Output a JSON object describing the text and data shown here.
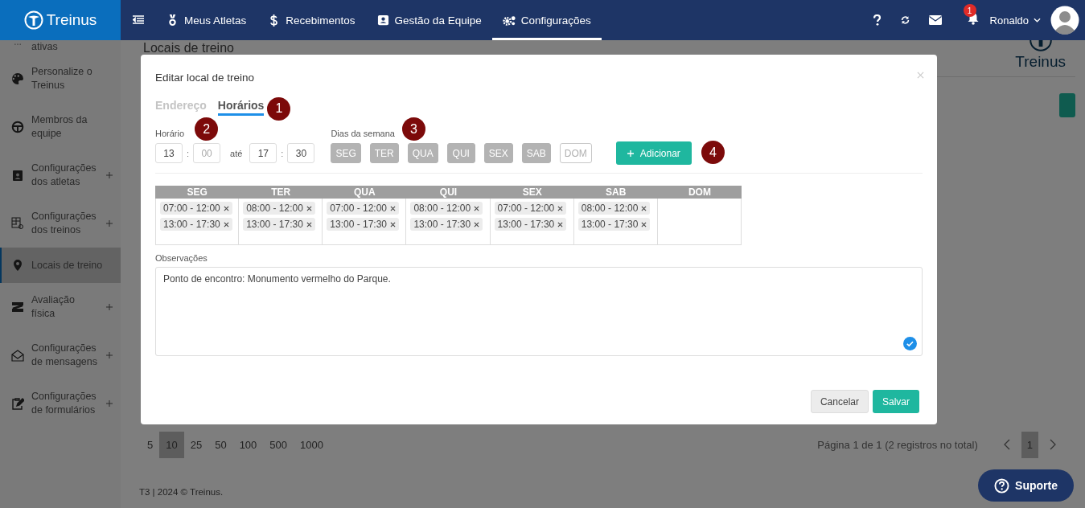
{
  "navbar": {
    "logo": "Treinus",
    "items": [
      {
        "label": "Meus Atletas",
        "selected": false
      },
      {
        "label": "Recebimentos",
        "selected": false
      },
      {
        "label": "Gestão da Equipe",
        "selected": false
      },
      {
        "label": "Configurações",
        "selected": true
      }
    ],
    "notification_count": "1",
    "user": "Ronaldo"
  },
  "sidebar": {
    "items": [
      {
        "label": "ativas",
        "expandable": false,
        "selected": false
      },
      {
        "label": "Personalize o Treinus",
        "expandable": false,
        "selected": false
      },
      {
        "label": "Membros da equipe",
        "expandable": false,
        "selected": false
      },
      {
        "label": "Configurações dos atletas",
        "expandable": true,
        "selected": false
      },
      {
        "label": "Configurações dos treinos",
        "expandable": true,
        "selected": false
      },
      {
        "label": "Locais de treino",
        "expandable": false,
        "selected": true
      },
      {
        "label": "Avaliação física",
        "expandable": true,
        "selected": false
      },
      {
        "label": "Configurações de mensagens",
        "expandable": true,
        "selected": false
      },
      {
        "label": "Configurações de formulários",
        "expandable": true,
        "selected": false
      }
    ]
  },
  "page": {
    "title": "Locais de treino",
    "background_logo": "Treinus",
    "page_sizes": [
      {
        "label": "5",
        "selected": false
      },
      {
        "label": "10",
        "selected": true
      },
      {
        "label": "25",
        "selected": false
      },
      {
        "label": "50",
        "selected": false
      },
      {
        "label": "100",
        "selected": false
      },
      {
        "label": "500",
        "selected": false
      },
      {
        "label": "1000",
        "selected": false
      }
    ],
    "page_info": "Página 1 de 1 (2 registros no total)",
    "pages": [
      {
        "label": "1",
        "selected": true
      }
    ],
    "footer": "T3  | 2024 © Treinus.",
    "support_button": "Suporte"
  },
  "modal": {
    "title": "Editar local de treino",
    "tabs": [
      {
        "label": "Endereço",
        "selected": false
      },
      {
        "label": "Horários",
        "selected": true
      }
    ],
    "markers": {
      "tabs": "1",
      "time": "2",
      "days": "3",
      "add": "4"
    },
    "time_label": "Horário",
    "start": {
      "hour": "13",
      "separator": ":",
      "minute_placeholder": "00"
    },
    "to_label": "até",
    "end": {
      "hour": "17",
      "separator": ":",
      "minute": "30"
    },
    "days_label": "Dias da semana",
    "days": [
      {
        "label": "SEG",
        "selected": true
      },
      {
        "label": "TER",
        "selected": true
      },
      {
        "label": "QUA",
        "selected": true
      },
      {
        "label": "QUI",
        "selected": true
      },
      {
        "label": "SEX",
        "selected": true
      },
      {
        "label": "SAB",
        "selected": true
      },
      {
        "label": "DOM",
        "selected": false
      }
    ],
    "add_button": "Adicionar",
    "schedule": [
      {
        "day": "SEG",
        "slots": [
          "07:00 - 12:00",
          "13:00 - 17:30"
        ]
      },
      {
        "day": "TER",
        "slots": [
          "08:00 - 12:00",
          "13:00 - 17:30"
        ]
      },
      {
        "day": "QUA",
        "slots": [
          "07:00 - 12:00",
          "13:00 - 17:30"
        ]
      },
      {
        "day": "QUI",
        "slots": [
          "08:00 - 12:00",
          "13:00 - 17:30"
        ]
      },
      {
        "day": "SEX",
        "slots": [
          "07:00 - 12:00",
          "13:00 - 17:30"
        ]
      },
      {
        "day": "SAB",
        "slots": [
          "08:00 - 12:00",
          "13:00 - 17:30"
        ]
      },
      {
        "day": "DOM"
      }
    ],
    "notes_label": "Observações",
    "notes": "Ponto de encontro: Monumento vermelho do Parque.",
    "buttons": [
      {
        "label": "Cancelar",
        "kind": "secondary"
      },
      {
        "label": "Salvar",
        "kind": "primary"
      }
    ]
  }
}
